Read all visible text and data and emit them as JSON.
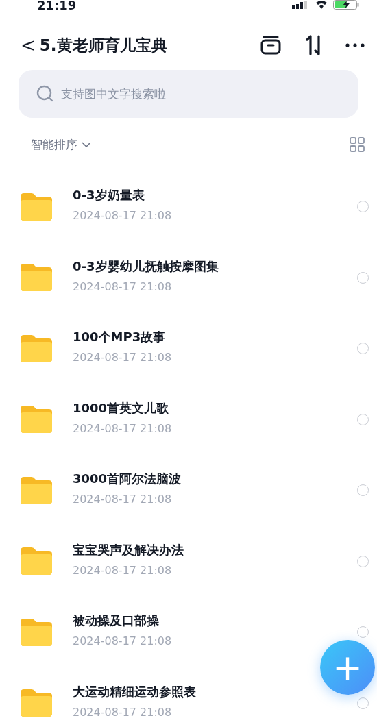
{
  "status_bar": {
    "time": "21:19"
  },
  "header": {
    "back": "<",
    "title": "5.黄老师育儿宝典"
  },
  "search": {
    "placeholder": "支持图中文字搜索啦"
  },
  "sort": {
    "label": "智能排序"
  },
  "files": [
    {
      "name": "0-3岁奶量表",
      "date": "2024-08-17 21:08",
      "selected": false
    },
    {
      "name": "0-3岁婴幼儿抚触按摩图集",
      "date": "2024-08-17 21:08",
      "selected": false
    },
    {
      "name": "100个MP3故事",
      "date": "2024-08-17 21:08",
      "selected": false
    },
    {
      "name": "1000首英文儿歌",
      "date": "2024-08-17 21:08",
      "selected": false
    },
    {
      "name": "3000首阿尔法脑波",
      "date": "2024-08-17 21:08",
      "selected": false
    },
    {
      "name": "宝宝哭声及解决办法",
      "date": "2024-08-17 21:08",
      "selected": false
    },
    {
      "name": "被动操及口部操",
      "date": "2024-08-17 21:08",
      "selected": false
    },
    {
      "name": "大运动精细运动参照表",
      "date": "2024-08-17 21:08",
      "selected": false
    }
  ],
  "fab": {
    "label": "+"
  }
}
